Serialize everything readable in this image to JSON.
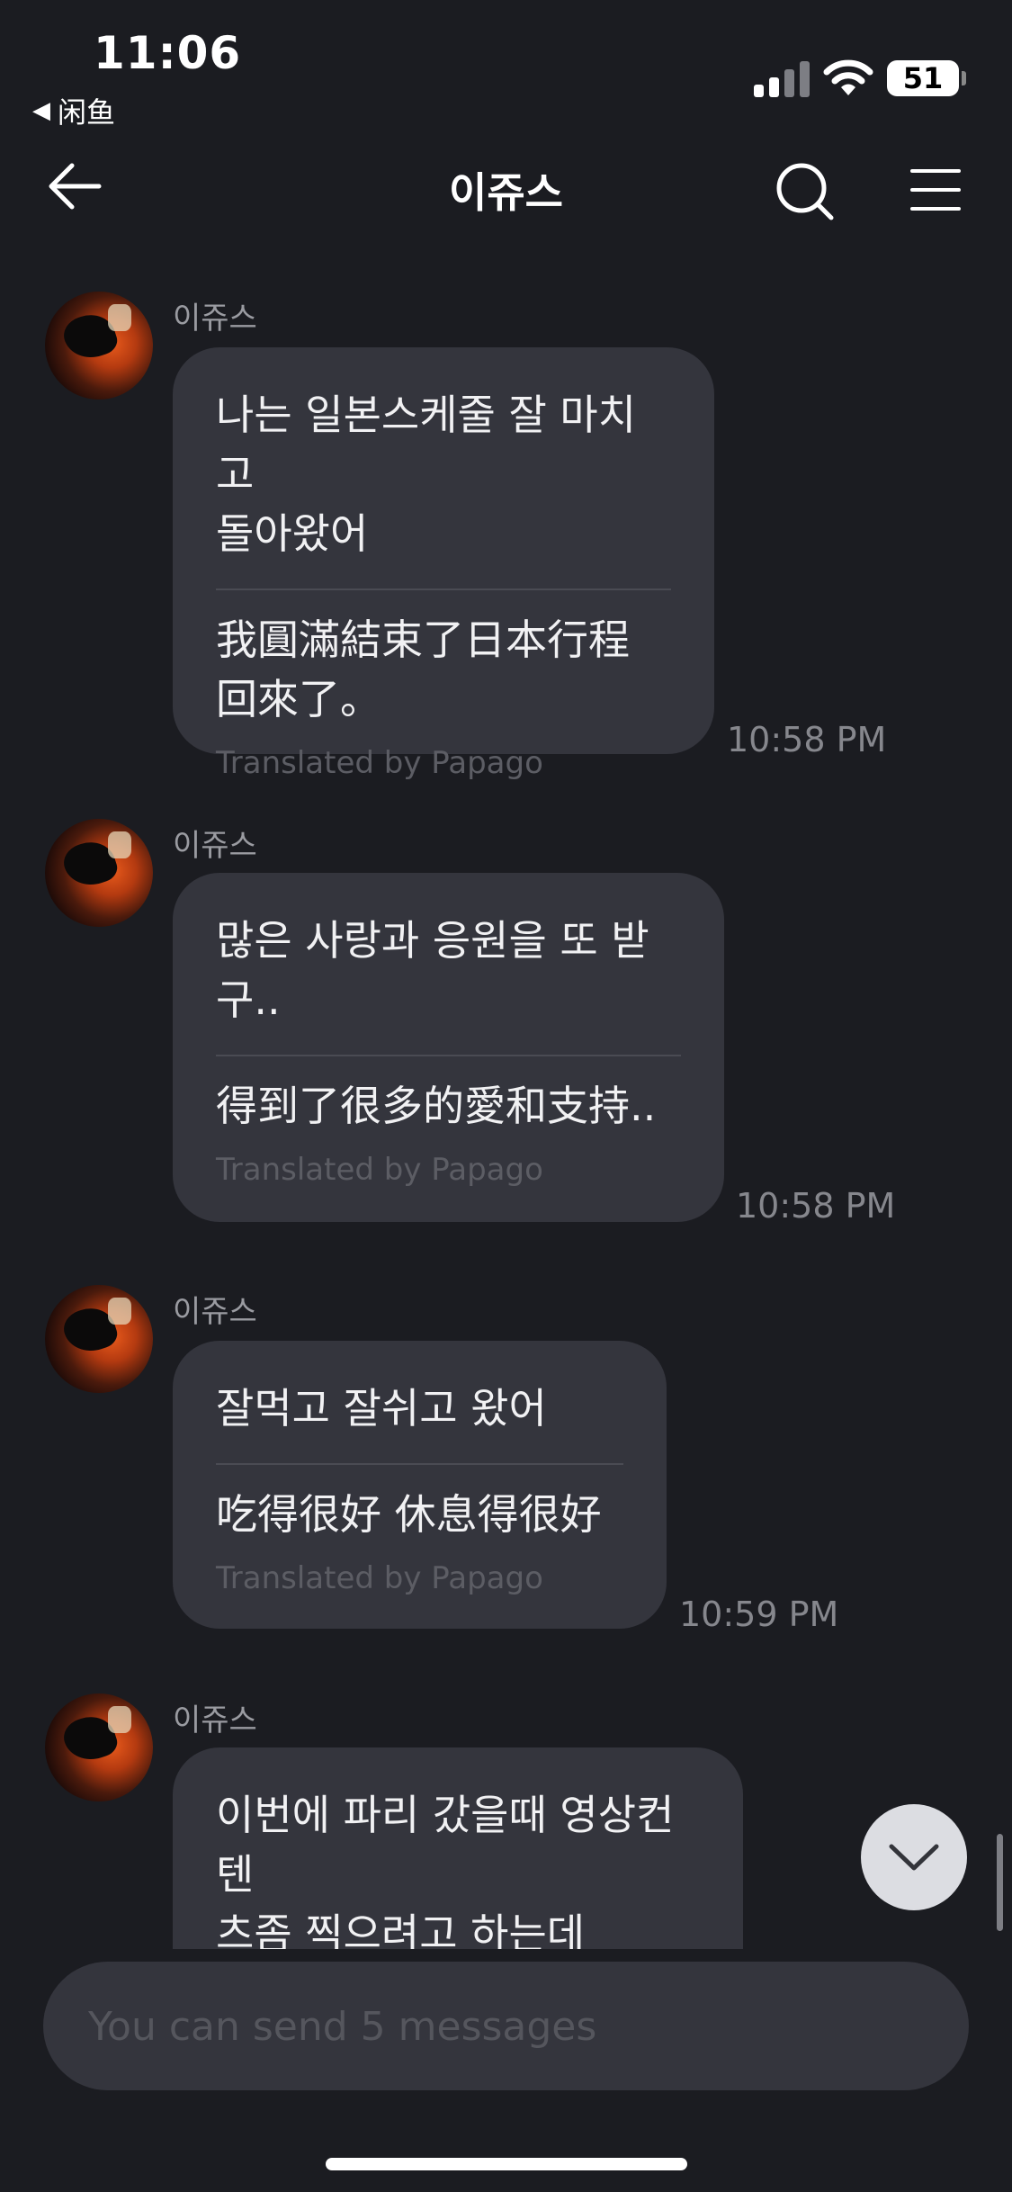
{
  "status_bar": {
    "time": "11:06",
    "back_app_label": "闲鱼",
    "battery": "51",
    "icons": [
      "signal-icon",
      "wifi-icon",
      "battery-icon"
    ]
  },
  "header": {
    "title": "이쥬스",
    "icons": [
      "back-arrow-icon",
      "search-icon",
      "menu-icon"
    ]
  },
  "messages": [
    {
      "sender": "이쥬스",
      "original": "나는 일본스케줄 잘 마치고\n돌아왔어",
      "translation": "我圓滿結束了日本行程\n回來了。",
      "credit": "Translated by Papago",
      "time": "10:58 PM"
    },
    {
      "sender": "이쥬스",
      "original": "많은 사랑과 응원을 또 받\n구..",
      "translation": "得到了很多的愛和支持..",
      "credit": "Translated by Papago",
      "time": "10:58 PM"
    },
    {
      "sender": "이쥬스",
      "original": "잘먹고 잘쉬고 왔어",
      "translation": "吃得很好 休息得很好",
      "credit": "Translated by Papago",
      "time": "10:59 PM"
    },
    {
      "sender": "이쥬스",
      "original": "이번에 파리 갔을때 영상컨텐\n츠좀 찍으려고 하는데"
    }
  ],
  "input": {
    "placeholder": "You can send 5 messages"
  },
  "colors": {
    "background": "#1b1c21",
    "bubble": "#34353d",
    "muted_text": "#86878d"
  }
}
